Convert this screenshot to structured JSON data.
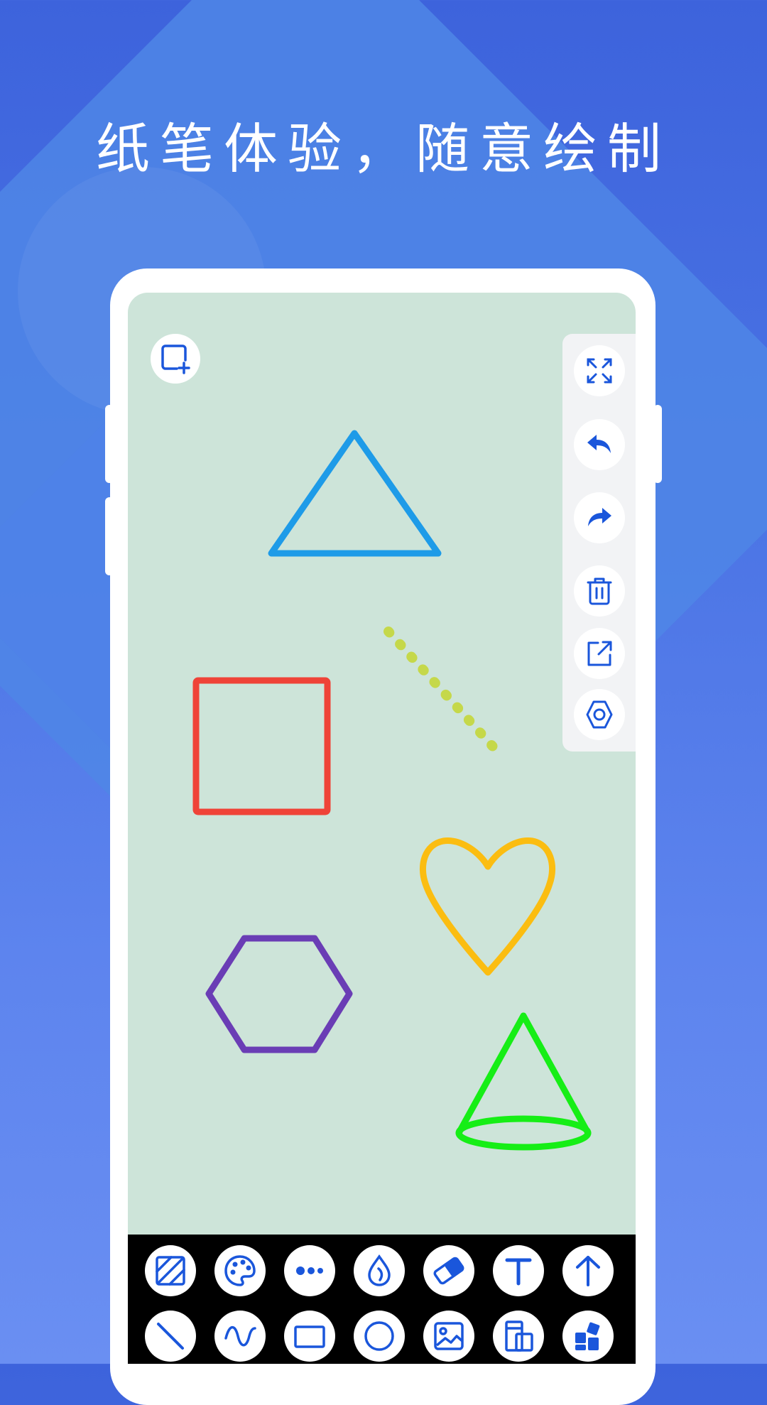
{
  "headline": "纸笔体验，随意绘制",
  "colors": {
    "background_top": "#3d63dc",
    "background_bottom": "#6a8ff2",
    "canvas": "#cde4d9",
    "icon_blue": "#1a56db",
    "toolbar": "#000000"
  },
  "canvas": {
    "new_canvas_icon": "add-canvas-icon",
    "shapes": [
      {
        "name": "triangle",
        "color": "#1e9be8"
      },
      {
        "name": "dotted-line",
        "color": "#c5d84a"
      },
      {
        "name": "square",
        "color": "#ef4338"
      },
      {
        "name": "heart",
        "color": "#fbbd11"
      },
      {
        "name": "hexagon",
        "color": "#6a3db5"
      },
      {
        "name": "cone",
        "color": "#16ee16"
      }
    ]
  },
  "right_panel": [
    {
      "name": "fullscreen",
      "icon": "expand-icon"
    },
    {
      "name": "undo",
      "icon": "undo-icon"
    },
    {
      "name": "redo",
      "icon": "redo-icon"
    },
    {
      "name": "delete",
      "icon": "trash-icon"
    },
    {
      "name": "share",
      "icon": "share-icon"
    },
    {
      "name": "settings",
      "icon": "settings-hexagon-icon"
    }
  ],
  "toolbar": {
    "row1": [
      "fill-pattern-icon",
      "palette-icon",
      "more-dots-icon",
      "ink-drop-icon",
      "eraser-icon",
      "text-icon",
      "arrow-up-icon"
    ],
    "row2": [
      "line-icon",
      "wave-icon",
      "rectangle-icon",
      "circle-icon",
      "image-icon",
      "layout-icon",
      "apps-icon"
    ]
  }
}
